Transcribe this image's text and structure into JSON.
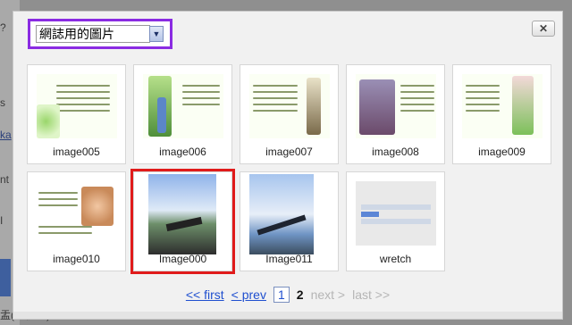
{
  "background_page": {
    "fragments": [
      "?",
      "s",
      "ka",
      "nt",
      "I",
      "盂(监视匡)"
    ]
  },
  "dialog": {
    "album_select": {
      "selected": "網誌用的圖片",
      "arrow_icon": "chevron-down-icon"
    },
    "close_icon": "close-icon",
    "close_glyph": "✕",
    "thumbnails": [
      {
        "label": "image005",
        "kind": "card"
      },
      {
        "label": "image006",
        "kind": "card"
      },
      {
        "label": "image007",
        "kind": "card"
      },
      {
        "label": "image008",
        "kind": "card"
      },
      {
        "label": "image009",
        "kind": "card"
      },
      {
        "label": "image010",
        "kind": "card"
      },
      {
        "label": "Image000",
        "kind": "photo",
        "selected": true
      },
      {
        "label": "Image011",
        "kind": "photo"
      },
      {
        "label": "wretch",
        "kind": "screenshot"
      }
    ],
    "pager": {
      "first": "<< first",
      "prev": "< prev",
      "page1": "1",
      "page2": "2",
      "next": "next >",
      "last": "last >>"
    }
  },
  "colors": {
    "select_highlight": "#8a2be2",
    "selected_thumb": "#e01b1b",
    "link": "#1f4fcf"
  }
}
